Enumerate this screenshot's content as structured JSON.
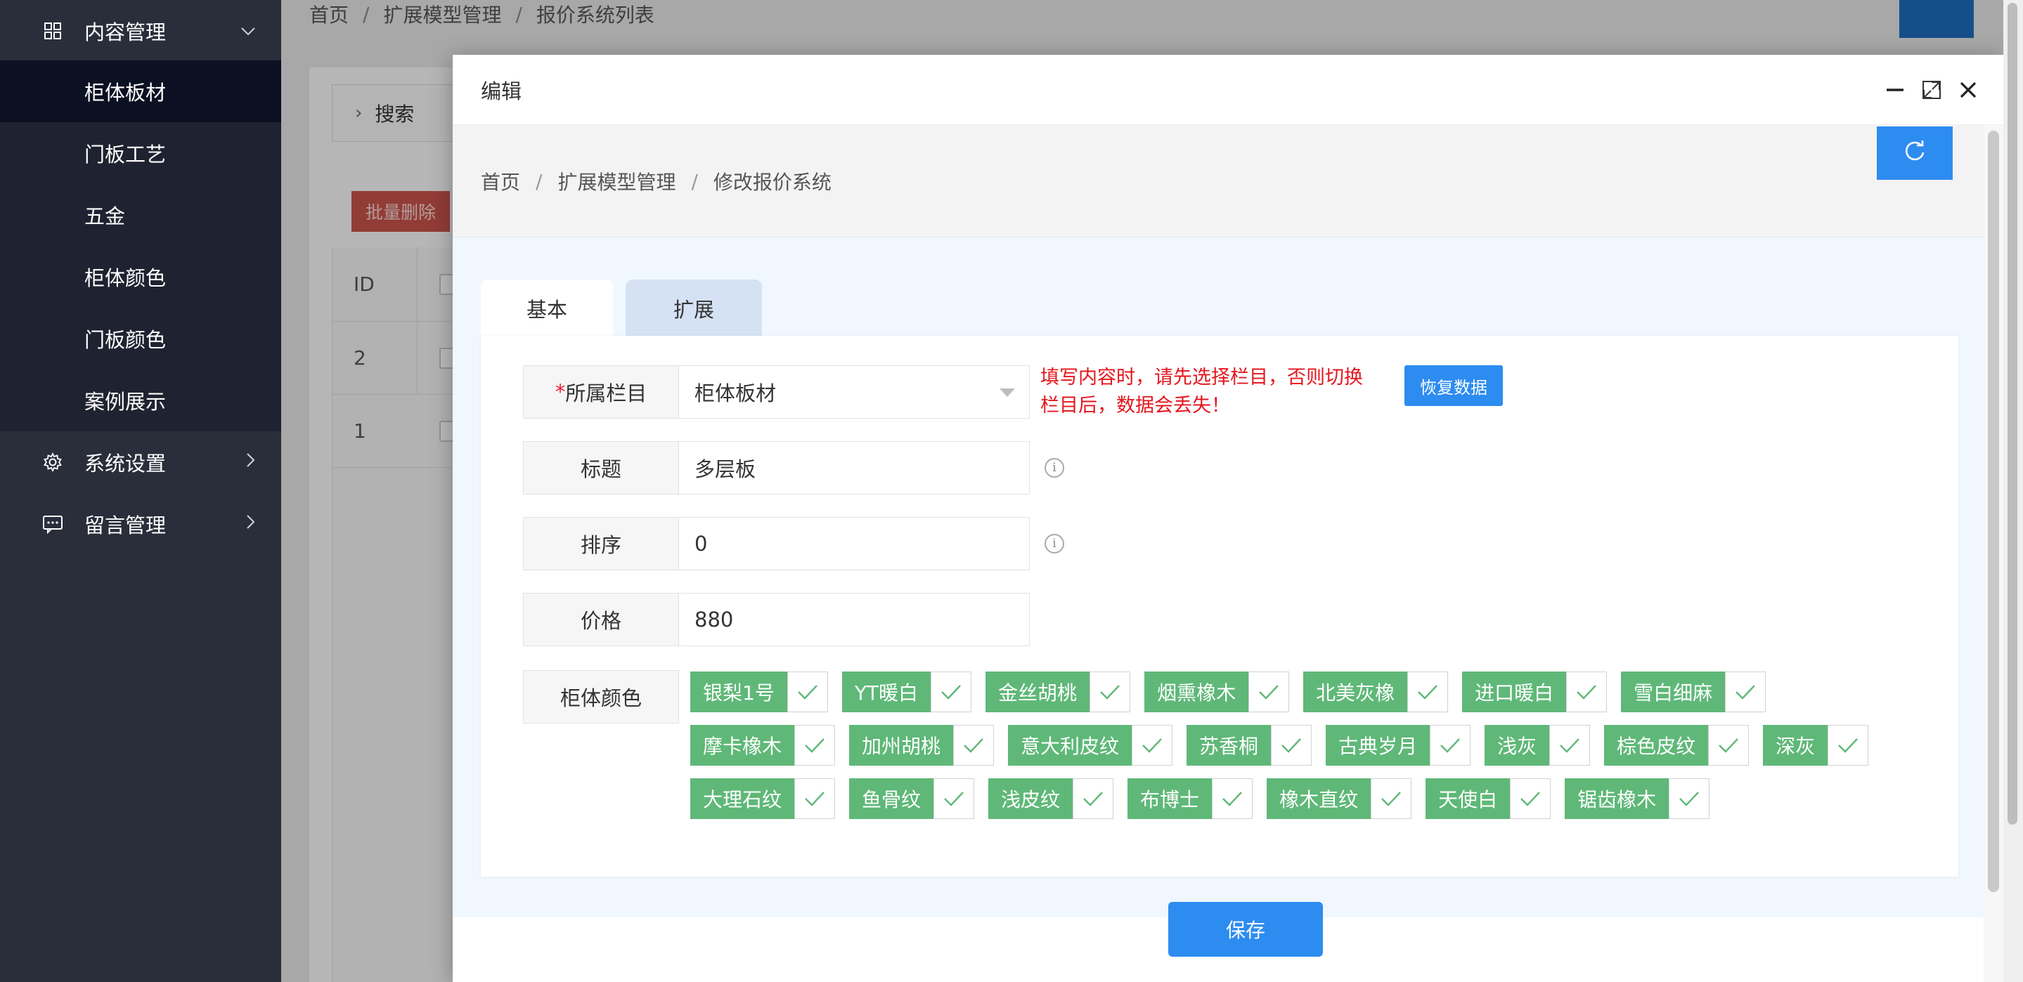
{
  "sidebar": {
    "top_items": [
      {
        "label": "内容管理",
        "icon": "grid-icon"
      },
      {
        "label": "系统设置",
        "icon": "gear-icon"
      },
      {
        "label": "留言管理",
        "icon": "message-icon"
      }
    ],
    "sub_items": [
      {
        "label": "柜体板材",
        "active": true
      },
      {
        "label": "门板工艺"
      },
      {
        "label": "五金"
      },
      {
        "label": "柜体颜色"
      },
      {
        "label": "门板颜色"
      },
      {
        "label": "案例展示"
      }
    ]
  },
  "background_page": {
    "breadcrumb": [
      "首页",
      "扩展模型管理",
      "报价系统列表"
    ],
    "search_label": "搜索",
    "batch_delete_label": "批量删除",
    "table": {
      "header": "ID",
      "rows": [
        "2",
        "1"
      ]
    }
  },
  "modal": {
    "title": "编辑",
    "breadcrumb": [
      "首页",
      "扩展模型管理",
      "修改报价系统"
    ],
    "tabs": [
      {
        "label": "基本"
      },
      {
        "label": "扩展"
      }
    ],
    "fields": {
      "category": {
        "label": "所属栏目",
        "required_mark": "*",
        "value": "柜体板材"
      },
      "title": {
        "label": "标题",
        "value": "多层板"
      },
      "sort": {
        "label": "排序",
        "value": "0"
      },
      "price": {
        "label": "价格",
        "value": "880"
      },
      "colors": {
        "label": "柜体颜色"
      }
    },
    "warning_line1": "填写内容时，请先选择栏目，否则切换",
    "warning_line2": "栏目后，数据会丢失！",
    "restore_label": "恢复数据",
    "info_glyph": "i",
    "color_options": [
      [
        "银梨1号",
        "YT暖白",
        "金丝胡桃",
        "烟熏橡木",
        "北美灰橡",
        "进口暖白",
        "雪白细麻"
      ],
      [
        "摩卡橡木",
        "加州胡桃",
        "意大利皮纹",
        "苏香桐",
        "古典岁月",
        "浅灰",
        "棕色皮纹",
        "深灰"
      ],
      [
        "大理石纹",
        "鱼骨纹",
        "浅皮纹",
        "布博士",
        "橡木直纹",
        "天使白",
        "锯齿橡木"
      ]
    ],
    "save_label": "保存"
  },
  "colors": {
    "accent": "#2d8cf0",
    "chip_green": "#5fb878",
    "warning_red": "#e4161d",
    "sidebar_bg": "#2a2e3b",
    "sidebar_active": "#0b1023"
  }
}
